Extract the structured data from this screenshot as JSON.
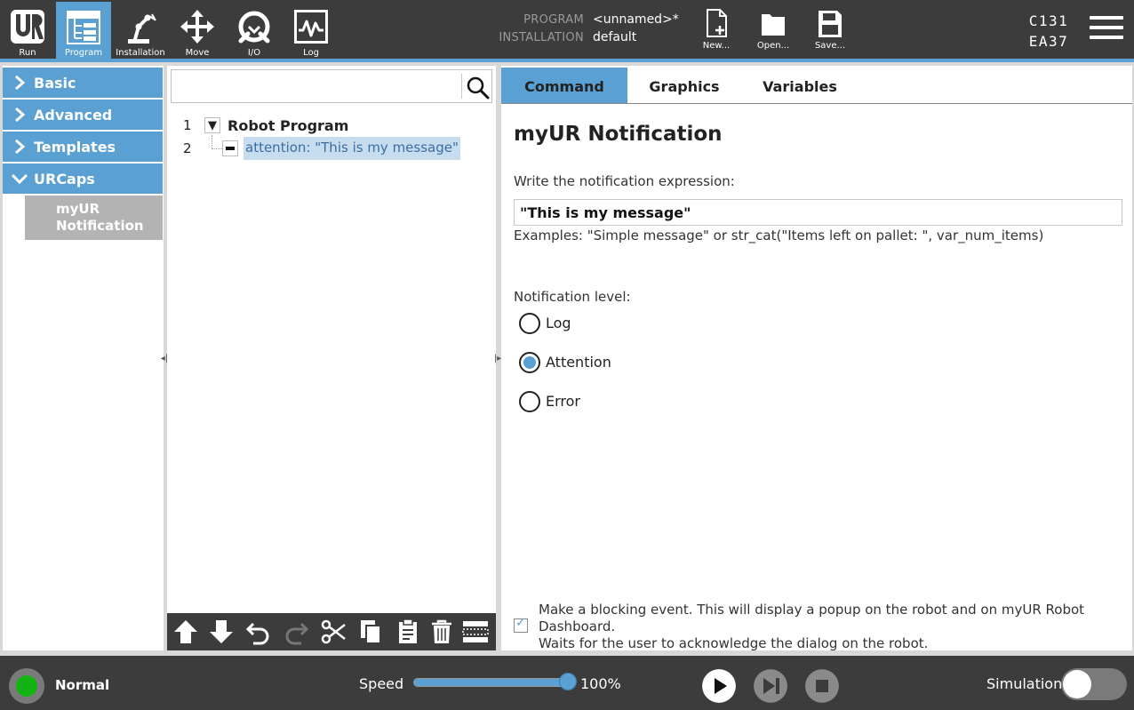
{
  "topbar": {
    "nav": [
      {
        "label": "Run",
        "icon": "ur-logo-icon"
      },
      {
        "label": "Program",
        "icon": "program-tree-icon",
        "active": true
      },
      {
        "label": "Installation",
        "icon": "robot-arm-icon"
      },
      {
        "label": "Move",
        "icon": "move-arrows-icon"
      },
      {
        "label": "I/O",
        "icon": "io-icon"
      },
      {
        "label": "Log",
        "icon": "log-waveform-icon"
      }
    ],
    "program_key": "PROGRAM",
    "program_value": "<unnamed>*",
    "installation_key": "INSTALLATION",
    "installation_value": "default",
    "file_buttons": [
      {
        "label": "New...",
        "icon": "new-file-icon"
      },
      {
        "label": "Open...",
        "icon": "folder-icon"
      },
      {
        "label": "Save...",
        "icon": "save-icon"
      }
    ],
    "robot_id_line1": "C131",
    "robot_id_line2": "EA37"
  },
  "sidebar": {
    "categories": [
      {
        "label": "Basic",
        "expanded": false
      },
      {
        "label": "Advanced",
        "expanded": false
      },
      {
        "label": "Templates",
        "expanded": false
      },
      {
        "label": "URCaps",
        "expanded": true
      }
    ],
    "urcap_item_line1": "myUR",
    "urcap_item_line2": "Notification"
  },
  "tree": {
    "search_value": "",
    "rows": [
      {
        "line": "1",
        "label": "Robot Program"
      },
      {
        "line": "2",
        "label": "attention: \"This is my message\""
      }
    ],
    "toolbar_icons": [
      "move-up-icon",
      "move-down-icon",
      "undo-icon",
      "redo-icon",
      "cut-icon",
      "copy-icon",
      "paste-icon",
      "delete-icon",
      "suppress-icon"
    ]
  },
  "panel": {
    "tabs": [
      "Command",
      "Graphics",
      "Variables"
    ],
    "active_tab": "Command",
    "title": "myUR Notification",
    "expr_label": "Write the notification expression:",
    "expr_value": "\"This is my message\"",
    "examples": "Examples: \"Simple message\" or str_cat(\"Items left on pallet: \", var_num_items)",
    "level_label": "Notification level:",
    "levels": [
      "Log",
      "Attention",
      "Error"
    ],
    "selected_level": "Attention",
    "blocking_checked": true,
    "blocking_line1": "Make a blocking event. This will display a popup on the robot and on myUR Robot",
    "blocking_line2": "Dashboard.",
    "blocking_line3": "Waits for the user to acknowledge the dialog on the robot."
  },
  "bottombar": {
    "status": "Normal",
    "status_color": "#13b313",
    "speed_label": "Speed",
    "speed_value": "100%",
    "speed_fraction": 1.0,
    "sim_label": "Simulation",
    "sim_on": false
  },
  "colors": {
    "accent": "#5aa0d2",
    "bar": "#3c3c3c"
  }
}
